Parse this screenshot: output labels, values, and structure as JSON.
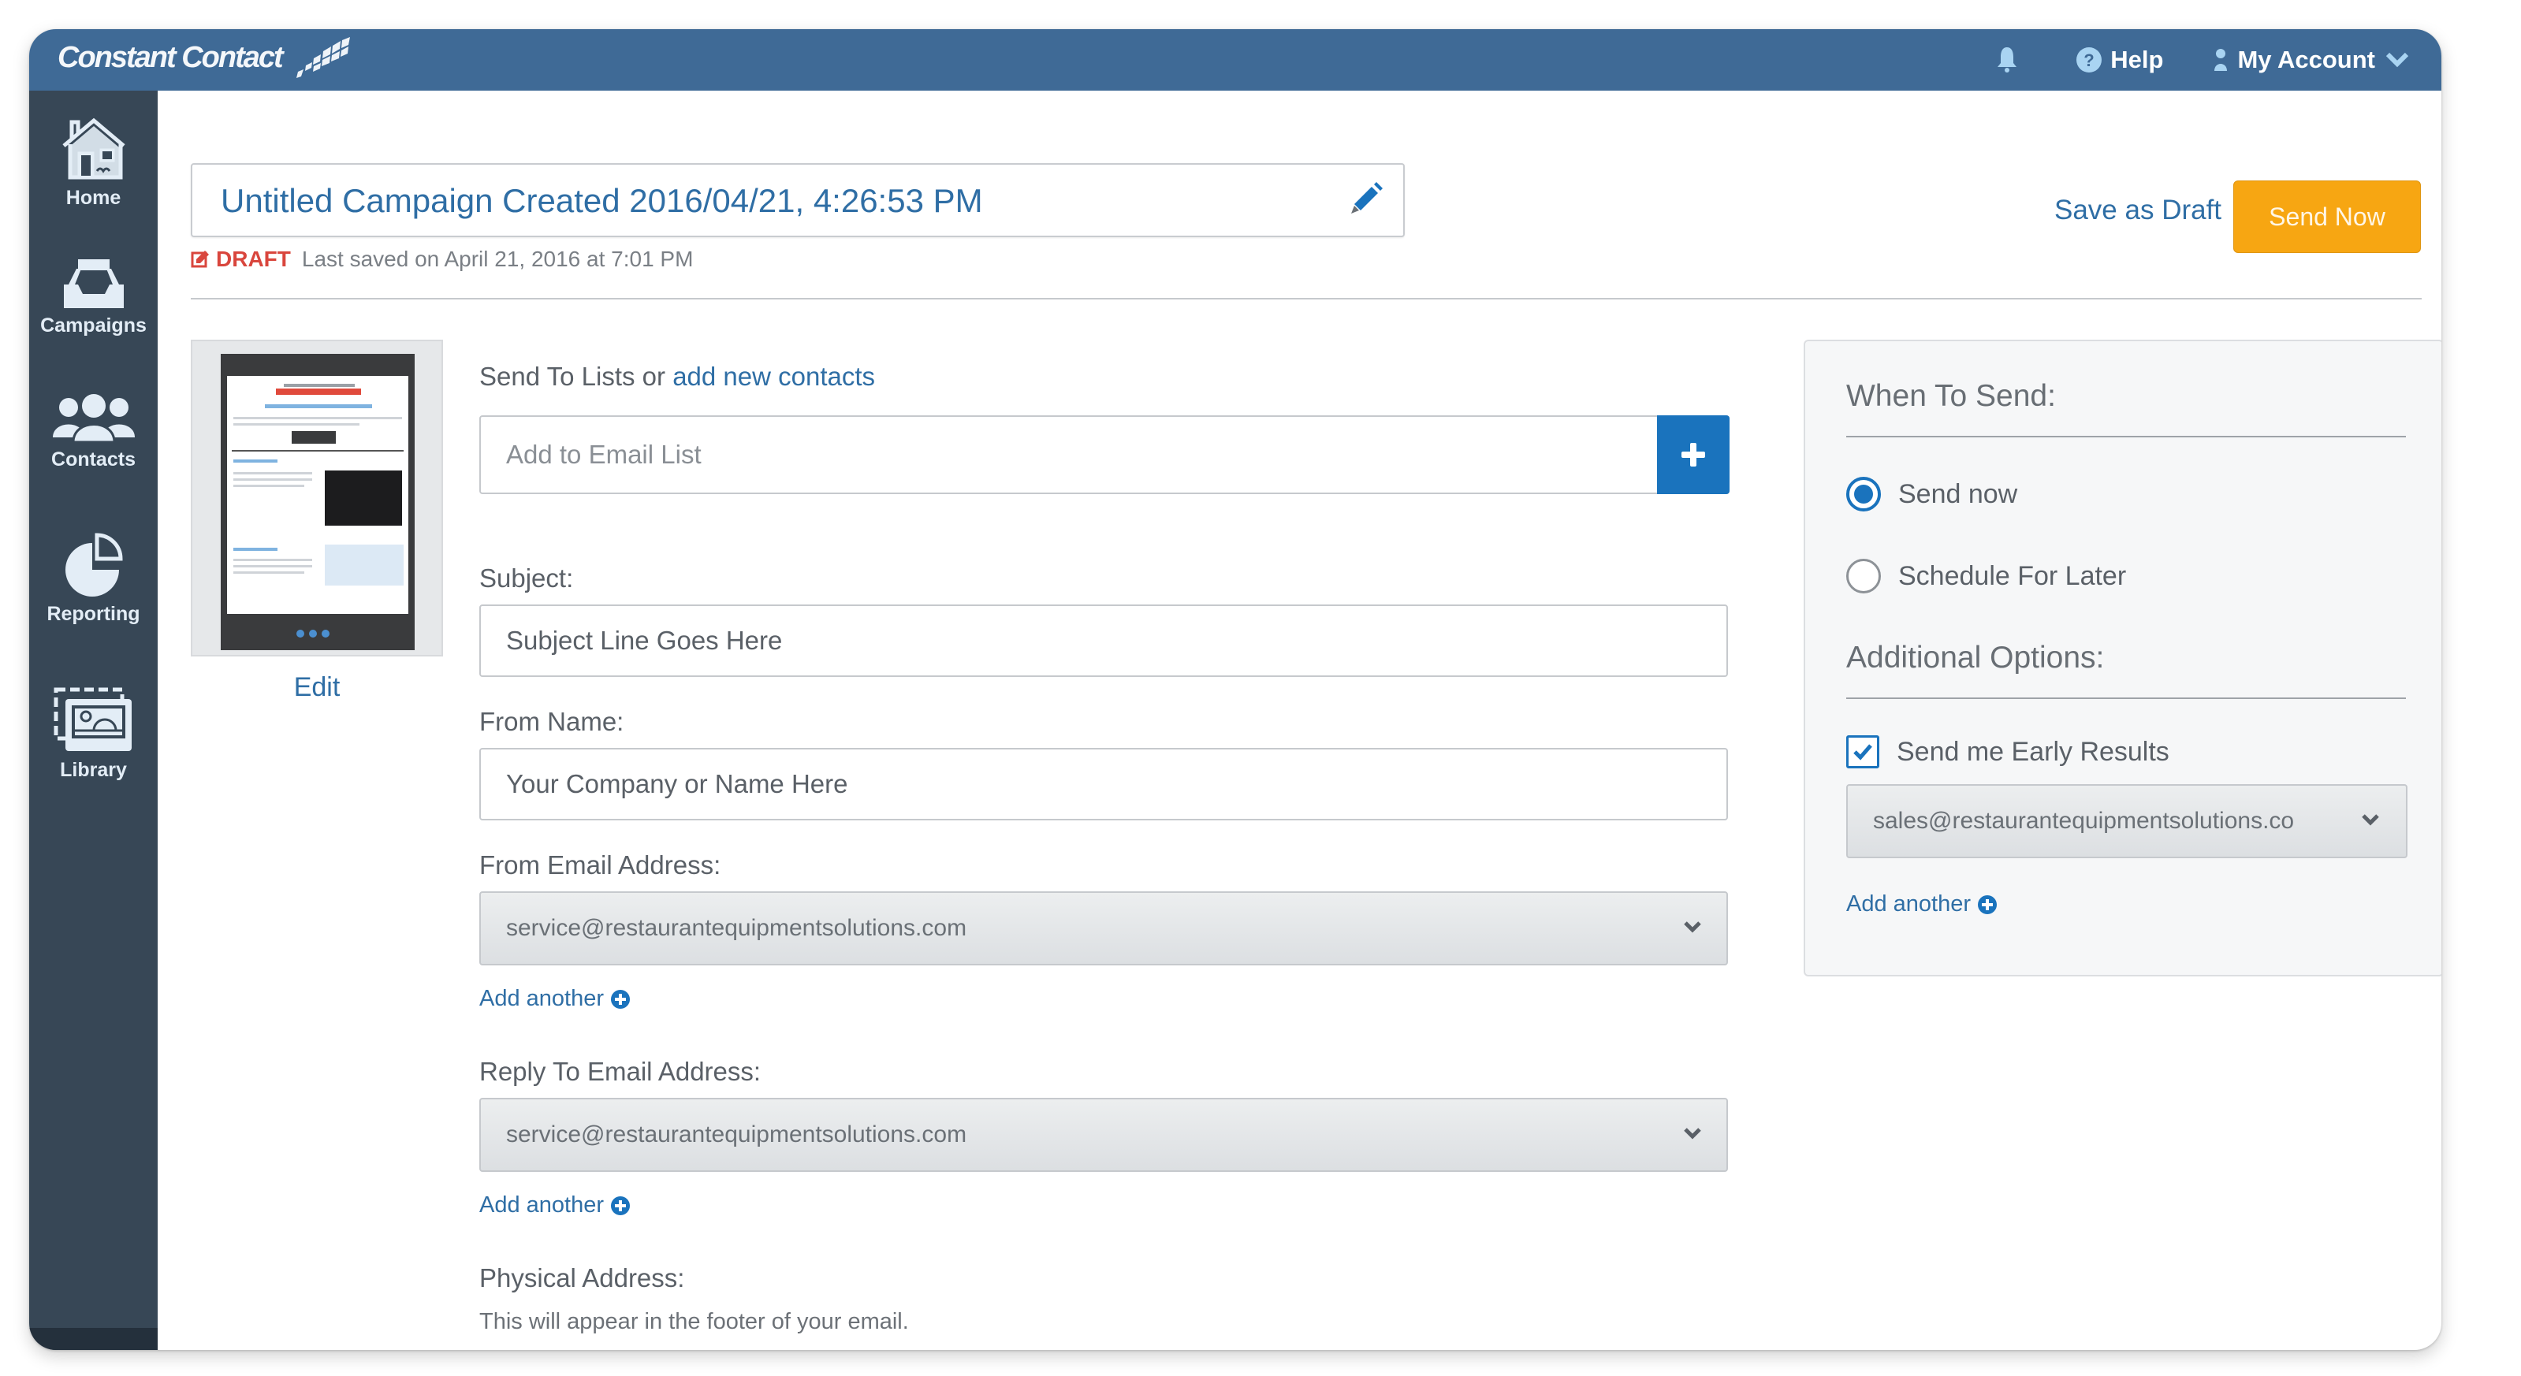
{
  "app": {
    "brand": "Constant Contact",
    "colors": {
      "header": "#3f6a96",
      "sidebar": "#374756",
      "link": "#2f6ea5",
      "primary_button": "#f7a612",
      "accent_blue": "#1a73bd",
      "draft_red": "#d9463d"
    }
  },
  "topbar": {
    "notifications_icon": "bell-icon",
    "help_label": "Help",
    "help_icon": "question-circle-icon",
    "account_label": "My Account",
    "account_icon": "user-icon",
    "account_chevron": "chevron-down-icon"
  },
  "sidebar": {
    "items": [
      {
        "label": "Home",
        "icon": "home-icon"
      },
      {
        "label": "Campaigns",
        "icon": "inbox-tray-icon"
      },
      {
        "label": "Contacts",
        "icon": "people-icon"
      },
      {
        "label": "Reporting",
        "icon": "pie-chart-icon"
      },
      {
        "label": "Library",
        "icon": "image-library-icon"
      }
    ]
  },
  "campaign": {
    "title": "Untitled Campaign Created 2016/04/21, 4:26:53 PM",
    "status": "DRAFT",
    "last_saved": "Last saved on April 21, 2016 at 7:01 PM",
    "save_draft_label": "Save as Draft",
    "send_now_label": "Send Now",
    "edit_label": "Edit"
  },
  "form": {
    "send_to_label": "Send To Lists or",
    "add_contacts_link": "add new contacts",
    "email_list_placeholder": "Add to Email List",
    "subject_label": "Subject:",
    "subject_value": "Subject Line Goes Here",
    "from_name_label": "From Name:",
    "from_name_value": "Your Company or Name Here",
    "from_email_label": "From Email Address:",
    "from_email_value": "service@restaurantequipmentsolutions.com",
    "add_another_label": "Add another",
    "reply_to_label": "Reply To Email Address:",
    "reply_to_value": "service@restaurantequipmentsolutions.com",
    "physical_address_label": "Physical Address:",
    "physical_address_hint": "This will appear in the footer of your email."
  },
  "send_panel": {
    "when_heading": "When To Send:",
    "options": [
      {
        "label": "Send now",
        "selected": true
      },
      {
        "label": "Schedule For Later",
        "selected": false
      }
    ],
    "additional_heading": "Additional Options:",
    "early_results_label": "Send me Early Results",
    "early_results_checked": true,
    "early_results_email": "sales@restaurantequipmentsolutions.co",
    "add_another_label": "Add another"
  }
}
